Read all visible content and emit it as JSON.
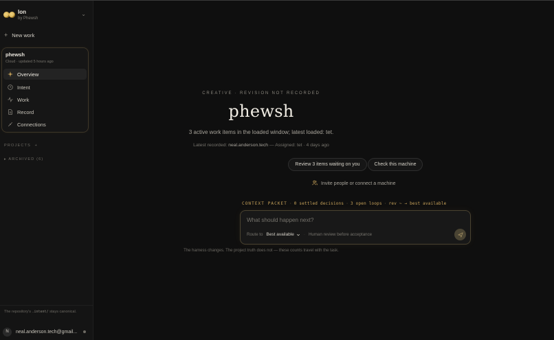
{
  "sidebar": {
    "brand": {
      "name": "Ion",
      "sub": "by Phewsh"
    },
    "new_work": "New work",
    "workspace": {
      "name": "phewsh",
      "meta": "Cloud · updated 5 hours ago"
    },
    "nav": [
      {
        "label": "Overview",
        "icon": "sparkle-icon",
        "active": true
      },
      {
        "label": "Intent",
        "icon": "clock-icon",
        "active": false
      },
      {
        "label": "Work",
        "icon": "activity-icon",
        "active": false
      },
      {
        "label": "Record",
        "icon": "document-icon",
        "active": false
      },
      {
        "label": "Connections",
        "icon": "plug-icon",
        "active": false
      }
    ],
    "projects_label": "PROJECTS",
    "projects_add": "+",
    "archived_label": "▸ ARCHIVED (6)",
    "footer_note_prefix": "The repository's ",
    "footer_note_code": ".intent/",
    "footer_note_suffix": " stays canonical.",
    "user": {
      "initial": "N",
      "email": "neal.anderson.tech@gmail..."
    }
  },
  "main": {
    "eyebrow": "CREATIVE · REVISION NOT RECORDED",
    "title": "phewsh",
    "subtitle": "3 active work items in the loaded window; latest loaded: tet.",
    "recorded_prefix": "Latest recorded: ",
    "recorded_email": "neal.anderson.tech",
    "recorded_suffix": " — Assigned: tet · 4 days ago",
    "review_button": "Review 3 items waiting on you",
    "check_button": "Check this machine",
    "invite_label": "Invite people or connect a machine",
    "packet": {
      "label": "CONTEXT PACKET",
      "decisions": "0 settled decisions",
      "loops": "3 open loops",
      "route": "rev ~ → best available"
    },
    "composer": {
      "placeholder": "What should happen next?",
      "route_label": "Route to",
      "route_value": "Best available",
      "review_note": "Human review before acceptance"
    },
    "tagline": "The harness changes. The project truth does not — these counts travel with the task."
  },
  "colors": {
    "accent": "#c9a35a",
    "background": "#0f0f0f",
    "sidebar": "#141414"
  }
}
